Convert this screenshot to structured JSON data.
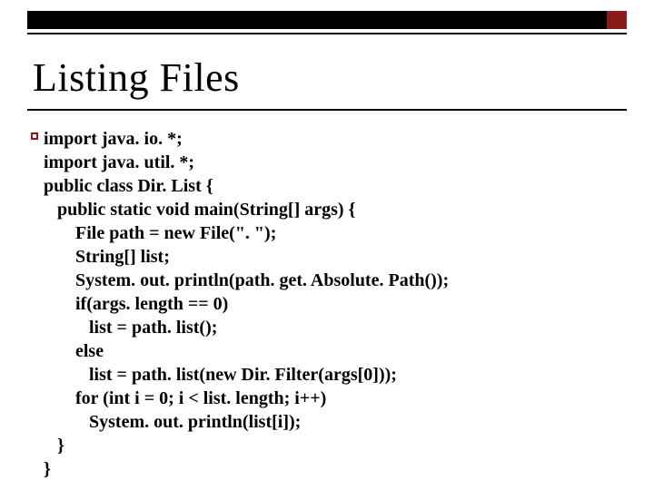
{
  "title": "Listing Files",
  "code": {
    "l1": "import java. io. *;",
    "l2": "import java. util. *;",
    "l3": "public class Dir. List {",
    "l4": "   public static void main(String[] args) {",
    "l5": "       File path = new File(\". \");",
    "l6": "       String[] list;",
    "l7": "       System. out. println(path. get. Absolute. Path());",
    "l8": "       if(args. length == 0)",
    "l9": "          list = path. list();",
    "l10": "       else",
    "l11": "          list = path. list(new Dir. Filter(args[0]));",
    "l12": "       for (int i = 0; i < list. length; i++)",
    "l13": "          System. out. println(list[i]);",
    "l14": "   }",
    "l15": "}"
  }
}
